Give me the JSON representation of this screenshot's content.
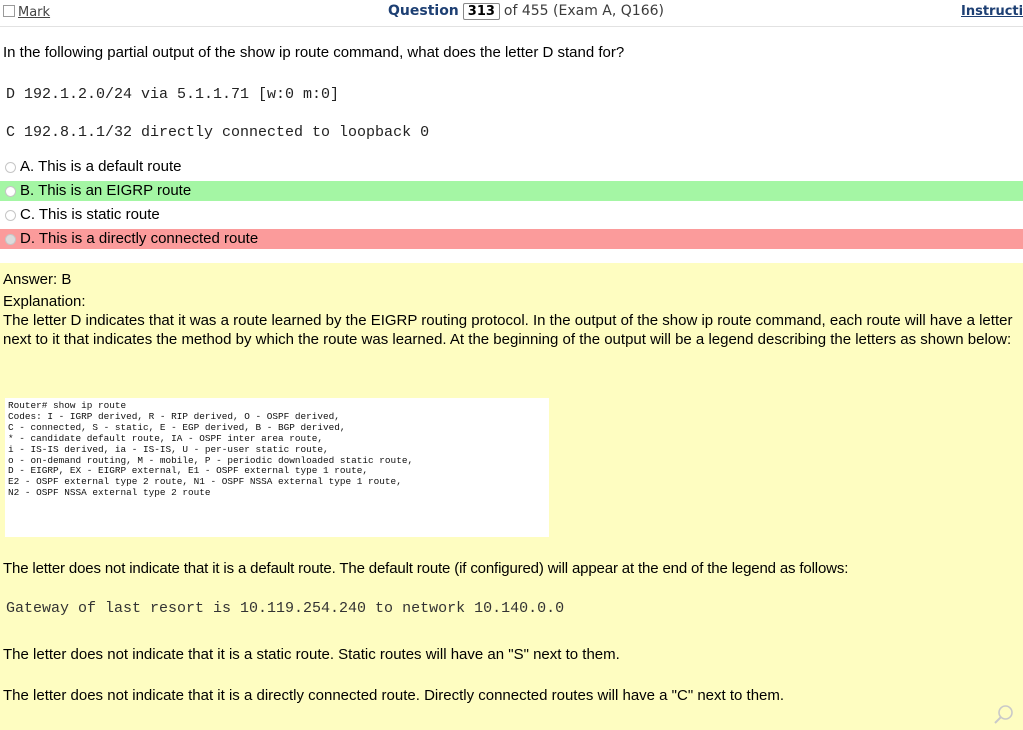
{
  "header": {
    "mark_label": "Mark",
    "question_word": "Question",
    "question_number": "313",
    "question_rest": "of 455 (Exam A, Q166)",
    "instructions_link": "Instructio"
  },
  "question": {
    "stem": "In the following partial output of the show ip route command, what does the letter D stand for?",
    "code_line_1": "D 192.1.2.0/24 via 5.1.1.71 [w:0 m:0]",
    "code_line_2": "C 192.8.1.1/32 directly connected to loopback 0"
  },
  "options": [
    {
      "label": "A. This is a default route",
      "state": "normal"
    },
    {
      "label": "B. This is an EIGRP route",
      "state": "correct"
    },
    {
      "label": "C. This is static route",
      "state": "normal"
    },
    {
      "label": "D. This is a directly connected route",
      "state": "selected-wrong"
    }
  ],
  "answer": {
    "answer_text": "Answer: B",
    "explanation_heading": "Explanation:",
    "explanation_text": "The letter D indicates that it was a route learned by the EIGRP routing protocol. In the output of the show ip route command, each route will have a letter next to it that indicates the method by which the route was learned. At the beginning of the output will be a legend describing the letters as shown below:",
    "legend_lines": [
      "Router# show ip route",
      "Codes: I - IGRP derived, R - RIP derived, O - OSPF derived,",
      "C - connected, S - static, E - EGP derived, B - BGP derived,",
      "* - candidate default route, IA - OSPF inter area route,",
      "i - IS-IS derived, ia - IS-IS, U - per-user static route,",
      "o - on-demand routing, M - mobile, P - periodic downloaded static route,",
      "D - EIGRP, EX - EIGRP external, E1 - OSPF external type 1 route,",
      "E2 - OSPF external type 2 route, N1 - OSPF NSSA external type 1 route,",
      "N2 - OSPF NSSA external type 2 route"
    ],
    "para_default": "The letter does not indicate that it is a default route. The default route (if configured) will appear at the end of the legend as follows:",
    "gateway_line": "Gateway of last resort is 10.119.254.240 to network 10.140.0.0",
    "para_static": "The letter does not indicate that it is a static route. Static routes will have an \"S\" next to them.",
    "para_connected": "The letter does not indicate that it is a directly connected route. Directly connected routes will have a \"C\" next to them."
  },
  "colors": {
    "correct_bg": "#a4f6a4",
    "wrong_bg": "#fb9b9b",
    "explanation_bg": "#fefdc1",
    "header_accent": "#1d3f73"
  },
  "icons": {
    "zoom": "magnifier-icon"
  }
}
